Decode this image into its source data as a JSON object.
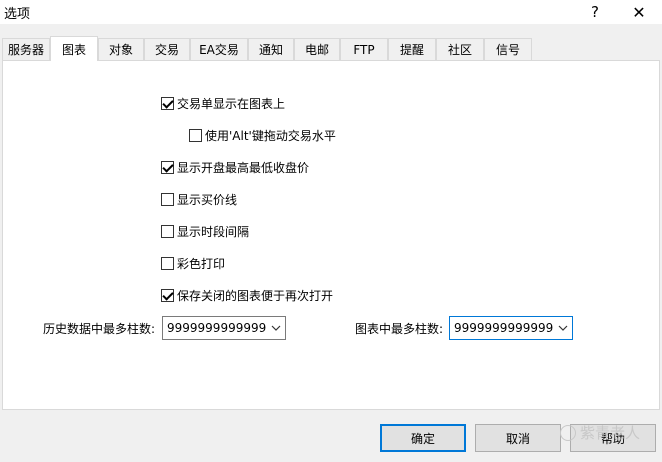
{
  "window": {
    "title": "选项",
    "help_glyph": "?",
    "close_glyph": "✕"
  },
  "tabs": [
    {
      "label": "服务器",
      "active": false
    },
    {
      "label": "图表",
      "active": true
    },
    {
      "label": "对象",
      "active": false
    },
    {
      "label": "交易",
      "active": false
    },
    {
      "label": "EA交易",
      "active": false
    },
    {
      "label": "通知",
      "active": false
    },
    {
      "label": "电邮",
      "active": false
    },
    {
      "label": "FTP",
      "active": false
    },
    {
      "label": "提醒",
      "active": false
    },
    {
      "label": "社区",
      "active": false
    },
    {
      "label": "信号",
      "active": false
    }
  ],
  "options": {
    "show_trade_levels": {
      "label": "交易单显示在图表上",
      "checked": true
    },
    "alt_drag_levels": {
      "label": "使用'Alt'键拖动交易水平",
      "checked": false
    },
    "show_ohlc": {
      "label": "显示开盘最高最低收盘价",
      "checked": true
    },
    "show_ask_line": {
      "label": "显示买价线",
      "checked": false
    },
    "show_period_separators": {
      "label": "显示时段间隔",
      "checked": false
    },
    "color_print": {
      "label": "彩色打印",
      "checked": false
    },
    "save_deleted_charts": {
      "label": "保存关闭的图表便于再次打开",
      "checked": true
    }
  },
  "fields": {
    "max_bars_history": {
      "label": "历史数据中最多柱数:",
      "value": "9999999999999"
    },
    "max_bars_chart": {
      "label": "图表中最多柱数:",
      "value": "9999999999999"
    }
  },
  "buttons": {
    "ok": "确定",
    "cancel": "取消",
    "help": "帮助"
  },
  "watermark": "紫青老人"
}
